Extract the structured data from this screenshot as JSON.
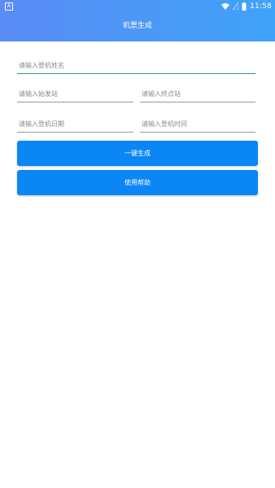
{
  "status_bar": {
    "app_icon_letter": "A",
    "time": "11:58"
  },
  "header": {
    "title": "机票生成"
  },
  "form": {
    "name_placeholder": "请输入登机姓名",
    "departure_placeholder": "请输入始发站",
    "destination_placeholder": "请输入终点站",
    "date_placeholder": "请输入登机日期",
    "time_placeholder": "请输入登机时间"
  },
  "buttons": {
    "generate": "一键生成",
    "help": "使用帮助"
  },
  "colors": {
    "header_start": "#5a8cf6",
    "header_end": "#3fa3f8",
    "button": "#0a86f5",
    "active_underline": "#1f9e8e"
  }
}
